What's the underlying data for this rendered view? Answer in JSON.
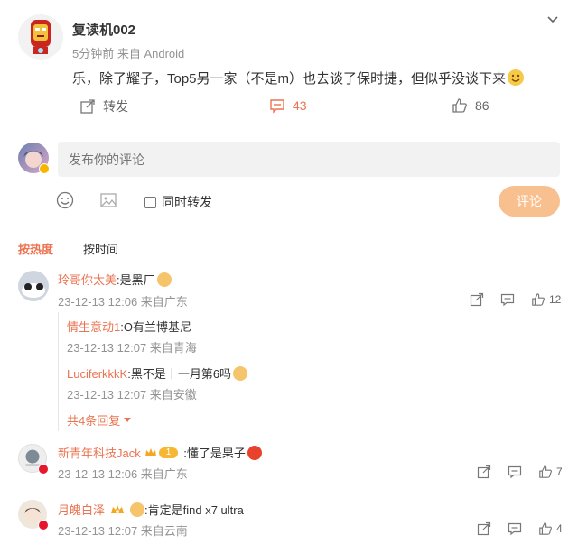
{
  "post": {
    "author": "复读机002",
    "meta": "5分钟前 来自 Android",
    "text": "乐，除了耀子，Top5另一家（不是m）也去谈了保时捷，但似乎没谈下来",
    "repost_label": "转发",
    "comment_count": "43",
    "like_count": "86"
  },
  "composer": {
    "placeholder": "发布你的评论",
    "also_repost_label": "同时转发",
    "submit_label": "评论"
  },
  "sort_tabs": {
    "hot": "按热度",
    "time": "按时间"
  },
  "comments": [
    {
      "user": "玲哥你太美",
      "text": ":是黑厂",
      "meta": "23-12-13 12:06 来自广东",
      "likes": "12",
      "replies": [
        {
          "user": "情生意动1",
          "text": ":O有兰博基尼",
          "meta": "23-12-13 12:07 来自青海"
        },
        {
          "user": "LuciferkkkK",
          "text": ":黑不是十一月第6吗",
          "meta": "23-12-13 12:07 来自安徽"
        }
      ],
      "more_replies": "共4条回复"
    },
    {
      "user": "新青年科技Jack",
      "badge_level": "1",
      "text": ":懂了是果子",
      "meta": "23-12-13 12:06 来自广东",
      "likes": "7"
    },
    {
      "user": "月魄白泽",
      "text": ":肯定是find x7 ultra",
      "meta": "23-12-13 12:07 来自云南",
      "likes": "4"
    }
  ],
  "colors": {
    "accent": "#eb7350",
    "submit_bg": "#f8c08f",
    "link": "#eb7350"
  }
}
